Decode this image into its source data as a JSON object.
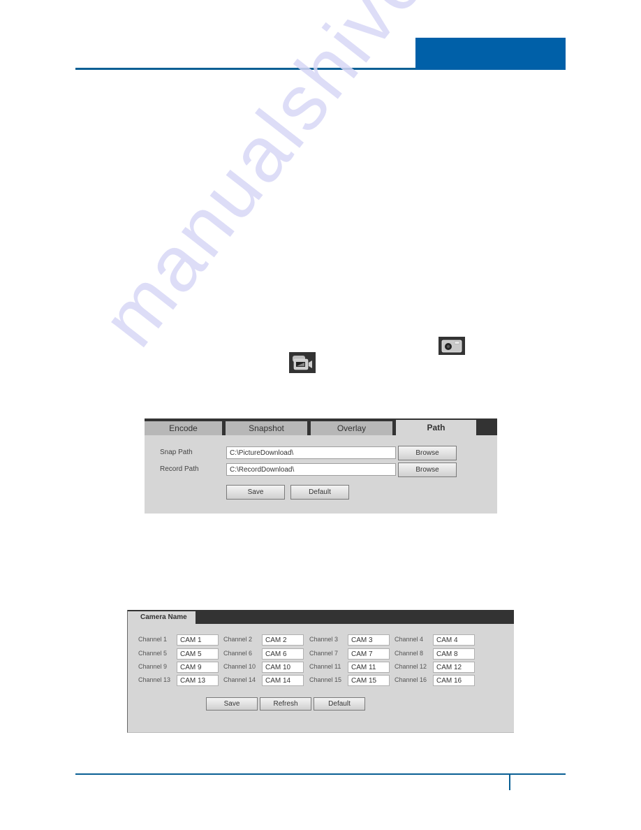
{
  "watermark": "manualshive.com",
  "icons": {
    "snapshot_icon": "snapshot-camera-icon",
    "record_icon": "video-record-icon"
  },
  "colors": {
    "header_blue": "#0060a8",
    "rule_blue": "#0a5f94",
    "panel_gray": "#d6d6d6",
    "tabbar_dark": "#333333"
  },
  "path_panel": {
    "tabs": [
      {
        "label": "Encode",
        "active": false
      },
      {
        "label": "Snapshot",
        "active": false
      },
      {
        "label": "Overlay",
        "active": false
      },
      {
        "label": "Path",
        "active": true
      }
    ],
    "rows": [
      {
        "label": "Snap Path",
        "value": "C:\\PictureDownload\\",
        "button": "Browse"
      },
      {
        "label": "Record Path",
        "value": "C:\\RecordDownload\\",
        "button": "Browse"
      }
    ],
    "save_label": "Save",
    "default_label": "Default"
  },
  "camera_name_panel": {
    "tab_label": "Camera Name",
    "channels": [
      {
        "label": "Channel 1",
        "value": "CAM 1"
      },
      {
        "label": "Channel 2",
        "value": "CAM 2"
      },
      {
        "label": "Channel 3",
        "value": "CAM 3"
      },
      {
        "label": "Channel 4",
        "value": "CAM 4"
      },
      {
        "label": "Channel 5",
        "value": "CAM 5"
      },
      {
        "label": "Channel 6",
        "value": "CAM 6"
      },
      {
        "label": "Channel 7",
        "value": "CAM 7"
      },
      {
        "label": "Channel 8",
        "value": "CAM 8"
      },
      {
        "label": "Channel 9",
        "value": "CAM 9"
      },
      {
        "label": "Channel 10",
        "value": "CAM 10"
      },
      {
        "label": "Channel 11",
        "value": "CAM 11"
      },
      {
        "label": "Channel 12",
        "value": "CAM 12"
      },
      {
        "label": "Channel 13",
        "value": "CAM 13"
      },
      {
        "label": "Channel 14",
        "value": "CAM 14"
      },
      {
        "label": "Channel 15",
        "value": "CAM 15"
      },
      {
        "label": "Channel 16",
        "value": "CAM 16"
      }
    ],
    "save_label": "Save",
    "refresh_label": "Refresh",
    "default_label": "Default"
  }
}
